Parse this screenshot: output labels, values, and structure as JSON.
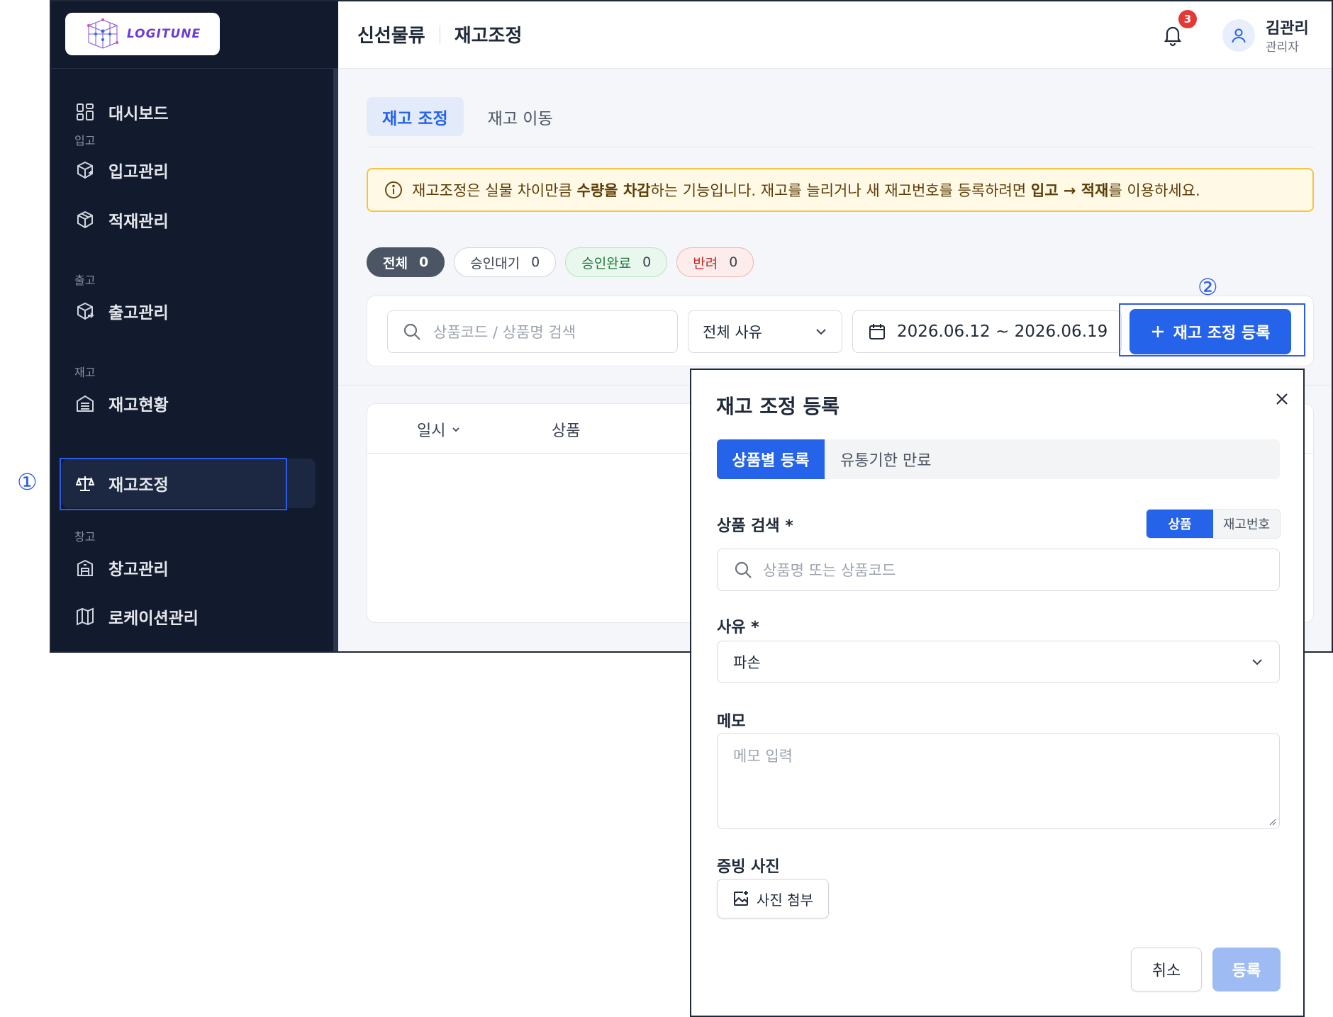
{
  "brand": {
    "logo_text": "LOGITUNE",
    "accent": "#2563eb",
    "sidebar_bg": "#121a2e"
  },
  "sidebar": {
    "items": [
      {
        "label": "대시보드",
        "icon": "dashboard-icon"
      },
      {
        "section": "입고"
      },
      {
        "label": "입고관리",
        "icon": "box-plus-icon"
      },
      {
        "label": "적재관리",
        "icon": "box-icon"
      },
      {
        "section": "출고"
      },
      {
        "label": "출고관리",
        "icon": "box-out-icon"
      },
      {
        "section": "재고"
      },
      {
        "label": "재고현황",
        "icon": "warehouse-icon"
      },
      {
        "label": "재고조정",
        "icon": "scale-icon",
        "active": true
      },
      {
        "section": "창고"
      },
      {
        "label": "창고관리",
        "icon": "building-icon"
      },
      {
        "label": "로케이션관리",
        "icon": "map-icon"
      }
    ]
  },
  "header": {
    "company": "신선물류",
    "page": "재고조정",
    "notification_count": "3",
    "user_name": "김관리",
    "user_role": "관리자"
  },
  "main": {
    "tabs": [
      {
        "label": "재고 조정",
        "active": true
      },
      {
        "label": "재고 이동"
      }
    ],
    "notice": {
      "t1": "재고조정은 실물 차이만큼 ",
      "b1": "수량을 차감",
      "t2": "하는 기능입니다. 재고를 늘리거나 새 재고번호를 등록하려면 ",
      "b2": "입고 → 적재",
      "t3": "를 이용하세요."
    },
    "status_chips": [
      {
        "label": "전체",
        "count": "0"
      },
      {
        "label": "승인대기",
        "count": "0"
      },
      {
        "label": "승인완료",
        "count": "0"
      },
      {
        "label": "반려",
        "count": "0"
      }
    ],
    "filter": {
      "search_placeholder": "상품코드 / 상품명 검색",
      "reason_select": "전체 사유",
      "date_range": "2026.06.12 ~ 2026.06.19",
      "register_button": "재고 조정 등록"
    },
    "table": {
      "columns": [
        "일시",
        "상품"
      ]
    }
  },
  "callouts": {
    "one": "①",
    "two": "②"
  },
  "modal": {
    "title": "재고 조정 등록",
    "tabs": [
      "상품별 등록",
      "유통기한 만료"
    ],
    "product_label": "상품 검색 *",
    "segment": [
      "상품",
      "재고번호"
    ],
    "product_placeholder": "상품명 또는 상품코드",
    "reason_label": "사유 *",
    "reason_value": "파손",
    "memo_label": "메모",
    "memo_placeholder": "메모 입력",
    "photo_label": "증빙 사진",
    "photo_button": "사진 첨부",
    "cancel": "취소",
    "submit": "등록"
  }
}
